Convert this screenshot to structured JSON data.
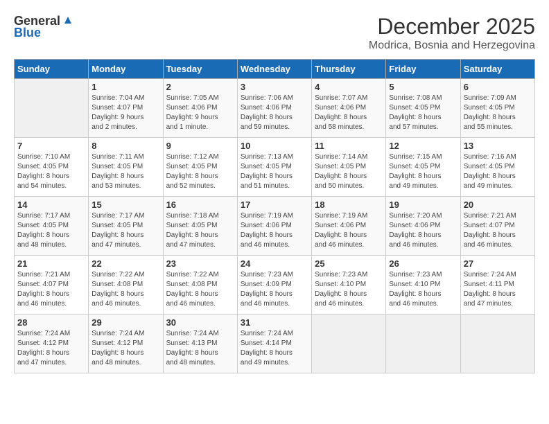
{
  "logo": {
    "general": "General",
    "blue": "Blue"
  },
  "title": {
    "month": "December 2025",
    "location": "Modrica, Bosnia and Herzegovina"
  },
  "weekdays": [
    "Sunday",
    "Monday",
    "Tuesday",
    "Wednesday",
    "Thursday",
    "Friday",
    "Saturday"
  ],
  "weeks": [
    [
      {
        "day": "",
        "info": ""
      },
      {
        "day": "1",
        "info": "Sunrise: 7:04 AM\nSunset: 4:07 PM\nDaylight: 9 hours\nand 2 minutes."
      },
      {
        "day": "2",
        "info": "Sunrise: 7:05 AM\nSunset: 4:06 PM\nDaylight: 9 hours\nand 1 minute."
      },
      {
        "day": "3",
        "info": "Sunrise: 7:06 AM\nSunset: 4:06 PM\nDaylight: 8 hours\nand 59 minutes."
      },
      {
        "day": "4",
        "info": "Sunrise: 7:07 AM\nSunset: 4:06 PM\nDaylight: 8 hours\nand 58 minutes."
      },
      {
        "day": "5",
        "info": "Sunrise: 7:08 AM\nSunset: 4:05 PM\nDaylight: 8 hours\nand 57 minutes."
      },
      {
        "day": "6",
        "info": "Sunrise: 7:09 AM\nSunset: 4:05 PM\nDaylight: 8 hours\nand 55 minutes."
      }
    ],
    [
      {
        "day": "7",
        "info": "Sunrise: 7:10 AM\nSunset: 4:05 PM\nDaylight: 8 hours\nand 54 minutes."
      },
      {
        "day": "8",
        "info": "Sunrise: 7:11 AM\nSunset: 4:05 PM\nDaylight: 8 hours\nand 53 minutes."
      },
      {
        "day": "9",
        "info": "Sunrise: 7:12 AM\nSunset: 4:05 PM\nDaylight: 8 hours\nand 52 minutes."
      },
      {
        "day": "10",
        "info": "Sunrise: 7:13 AM\nSunset: 4:05 PM\nDaylight: 8 hours\nand 51 minutes."
      },
      {
        "day": "11",
        "info": "Sunrise: 7:14 AM\nSunset: 4:05 PM\nDaylight: 8 hours\nand 50 minutes."
      },
      {
        "day": "12",
        "info": "Sunrise: 7:15 AM\nSunset: 4:05 PM\nDaylight: 8 hours\nand 49 minutes."
      },
      {
        "day": "13",
        "info": "Sunrise: 7:16 AM\nSunset: 4:05 PM\nDaylight: 8 hours\nand 49 minutes."
      }
    ],
    [
      {
        "day": "14",
        "info": "Sunrise: 7:17 AM\nSunset: 4:05 PM\nDaylight: 8 hours\nand 48 minutes."
      },
      {
        "day": "15",
        "info": "Sunrise: 7:17 AM\nSunset: 4:05 PM\nDaylight: 8 hours\nand 47 minutes."
      },
      {
        "day": "16",
        "info": "Sunrise: 7:18 AM\nSunset: 4:05 PM\nDaylight: 8 hours\nand 47 minutes."
      },
      {
        "day": "17",
        "info": "Sunrise: 7:19 AM\nSunset: 4:06 PM\nDaylight: 8 hours\nand 46 minutes."
      },
      {
        "day": "18",
        "info": "Sunrise: 7:19 AM\nSunset: 4:06 PM\nDaylight: 8 hours\nand 46 minutes."
      },
      {
        "day": "19",
        "info": "Sunrise: 7:20 AM\nSunset: 4:06 PM\nDaylight: 8 hours\nand 46 minutes."
      },
      {
        "day": "20",
        "info": "Sunrise: 7:21 AM\nSunset: 4:07 PM\nDaylight: 8 hours\nand 46 minutes."
      }
    ],
    [
      {
        "day": "21",
        "info": "Sunrise: 7:21 AM\nSunset: 4:07 PM\nDaylight: 8 hours\nand 46 minutes."
      },
      {
        "day": "22",
        "info": "Sunrise: 7:22 AM\nSunset: 4:08 PM\nDaylight: 8 hours\nand 46 minutes."
      },
      {
        "day": "23",
        "info": "Sunrise: 7:22 AM\nSunset: 4:08 PM\nDaylight: 8 hours\nand 46 minutes."
      },
      {
        "day": "24",
        "info": "Sunrise: 7:23 AM\nSunset: 4:09 PM\nDaylight: 8 hours\nand 46 minutes."
      },
      {
        "day": "25",
        "info": "Sunrise: 7:23 AM\nSunset: 4:10 PM\nDaylight: 8 hours\nand 46 minutes."
      },
      {
        "day": "26",
        "info": "Sunrise: 7:23 AM\nSunset: 4:10 PM\nDaylight: 8 hours\nand 46 minutes."
      },
      {
        "day": "27",
        "info": "Sunrise: 7:24 AM\nSunset: 4:11 PM\nDaylight: 8 hours\nand 47 minutes."
      }
    ],
    [
      {
        "day": "28",
        "info": "Sunrise: 7:24 AM\nSunset: 4:12 PM\nDaylight: 8 hours\nand 47 minutes."
      },
      {
        "day": "29",
        "info": "Sunrise: 7:24 AM\nSunset: 4:12 PM\nDaylight: 8 hours\nand 48 minutes."
      },
      {
        "day": "30",
        "info": "Sunrise: 7:24 AM\nSunset: 4:13 PM\nDaylight: 8 hours\nand 48 minutes."
      },
      {
        "day": "31",
        "info": "Sunrise: 7:24 AM\nSunset: 4:14 PM\nDaylight: 8 hours\nand 49 minutes."
      },
      {
        "day": "",
        "info": ""
      },
      {
        "day": "",
        "info": ""
      },
      {
        "day": "",
        "info": ""
      }
    ]
  ]
}
